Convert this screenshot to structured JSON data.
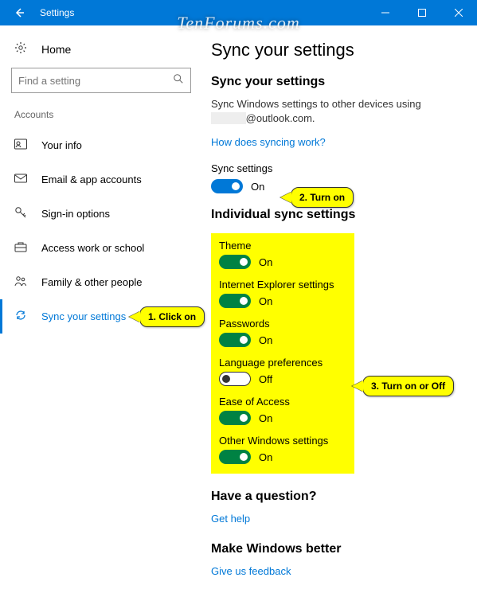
{
  "window": {
    "title": "Settings"
  },
  "watermark": "TenForums.com",
  "sidebar": {
    "home": "Home",
    "search_placeholder": "Find a setting",
    "group": "Accounts",
    "items": [
      {
        "label": "Your info"
      },
      {
        "label": "Email & app accounts"
      },
      {
        "label": "Sign-in options"
      },
      {
        "label": "Access work or school"
      },
      {
        "label": "Family & other people"
      },
      {
        "label": "Sync your settings"
      }
    ]
  },
  "main": {
    "title": "Sync your settings",
    "subtitle": "Sync your settings",
    "desc_line1": "Sync Windows settings to other devices using",
    "desc_line2": "@outlook.com.",
    "help_link": "How does syncing work?",
    "sync_label": "Sync settings",
    "sync_state": "On",
    "section2": "Individual sync settings",
    "items": [
      {
        "label": "Theme",
        "state": "On",
        "on": true
      },
      {
        "label": "Internet Explorer settings",
        "state": "On",
        "on": true
      },
      {
        "label": "Passwords",
        "state": "On",
        "on": true
      },
      {
        "label": "Language preferences",
        "state": "Off",
        "on": false
      },
      {
        "label": "Ease of Access",
        "state": "On",
        "on": true
      },
      {
        "label": "Other Windows settings",
        "state": "On",
        "on": true
      }
    ],
    "question_heading": "Have a question?",
    "get_help": "Get help",
    "better_heading": "Make Windows better",
    "feedback": "Give us feedback"
  },
  "callouts": {
    "c1": "1. Click on",
    "c2": "2. Turn on",
    "c3": "3. Turn on or Off"
  }
}
